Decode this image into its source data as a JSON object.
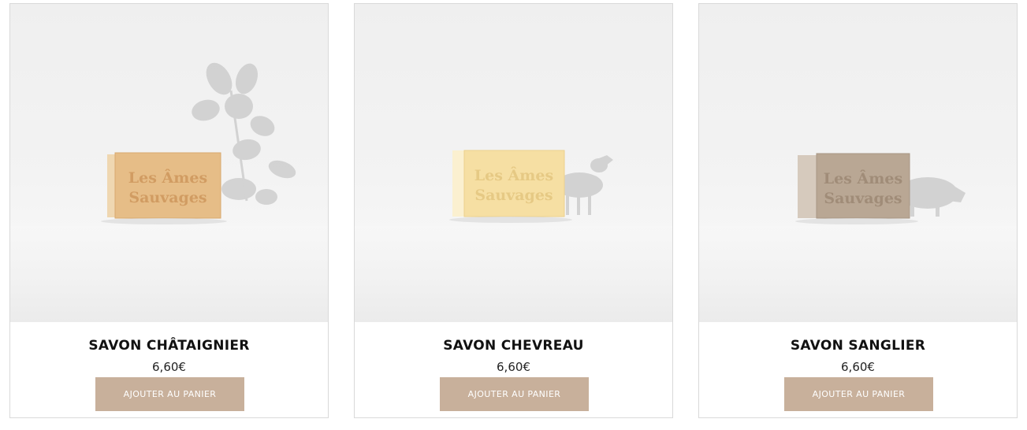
{
  "products": [
    {
      "name": "SAVON CHÂTAIGNIER",
      "price": "6,60€",
      "button_label": "AJOUTER AU PANIER",
      "image_alt_icon": "chestnut-leaf-shadow",
      "soap_color": "#e6bd87",
      "soap_side_color": "#efd7b1",
      "soap_stamp_line1": "Les Âmes",
      "soap_stamp_line2": "Sauvages"
    },
    {
      "name": "SAVON CHEVREAU",
      "price": "6,60€",
      "button_label": "AJOUTER AU PANIER",
      "image_alt_icon": "goat-shadow",
      "soap_color": "#f6dfa3",
      "soap_side_color": "#fbf0d0",
      "soap_stamp_line1": "Les Âmes",
      "soap_stamp_line2": "Sauvages"
    },
    {
      "name": "SAVON SANGLIER",
      "price": "6,60€",
      "button_label": "AJOUTER AU PANIER",
      "image_alt_icon": "boar-shadow",
      "soap_color": "#b9a794",
      "soap_side_color": "#d6cabd",
      "soap_stamp_line1": "Les Âmes",
      "soap_stamp_line2": "Sauvages"
    }
  ],
  "colors": {
    "button_bg": "#c8b09b",
    "button_text": "#ffffff",
    "card_border": "#d9d9d9"
  }
}
